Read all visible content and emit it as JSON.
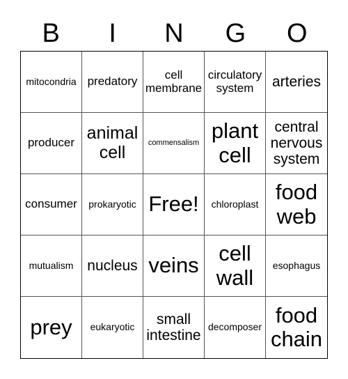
{
  "header": {
    "letters": [
      "B",
      "I",
      "N",
      "G",
      "O"
    ]
  },
  "cells": [
    [
      {
        "text": "mitocondria",
        "size": "s-sm"
      },
      {
        "text": "predatory",
        "size": "s-md"
      },
      {
        "text": "cell membrane",
        "size": "s-md"
      },
      {
        "text": "circulatory system",
        "size": "s-md"
      },
      {
        "text": "arteries",
        "size": "s-lg"
      }
    ],
    [
      {
        "text": "producer",
        "size": "s-md"
      },
      {
        "text": "animal cell",
        "size": "s-xl"
      },
      {
        "text": "commensalism",
        "size": "s-xs"
      },
      {
        "text": "plant cell",
        "size": "s-xxl"
      },
      {
        "text": "central nervous system",
        "size": "s-lg"
      }
    ],
    [
      {
        "text": "consumer",
        "size": "s-md"
      },
      {
        "text": "prokaryotic",
        "size": "s-sm"
      },
      {
        "text": "Free!",
        "size": "s-xxl"
      },
      {
        "text": "chloroplast",
        "size": "s-sm"
      },
      {
        "text": "food web",
        "size": "s-xxl"
      }
    ],
    [
      {
        "text": "mutualism",
        "size": "s-sm"
      },
      {
        "text": "nucleus",
        "size": "s-lg"
      },
      {
        "text": "veins",
        "size": "s-xxl"
      },
      {
        "text": "cell wall",
        "size": "s-xxl"
      },
      {
        "text": "esophagus",
        "size": "s-sm"
      }
    ],
    [
      {
        "text": "prey",
        "size": "s-xxl"
      },
      {
        "text": "eukaryotic",
        "size": "s-sm"
      },
      {
        "text": "small intestine",
        "size": "s-lg"
      },
      {
        "text": "decomposer",
        "size": "s-sm"
      },
      {
        "text": "food chain",
        "size": "s-xxl"
      }
    ]
  ]
}
